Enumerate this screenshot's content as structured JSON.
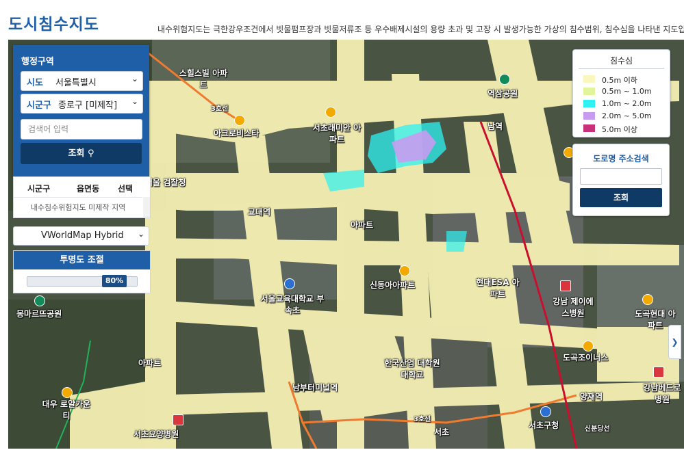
{
  "header": {
    "title": "도시침수지도",
    "description": "내수위험지도는 극한강우조건에서 빗물펌프장과 빗물저류조 등 우수배제시설의 용량 초과 및 고장 시 발생가능한 가상의 침수범위, 침수심을 나타낸 지도입"
  },
  "admin_panel": {
    "title": "행정구역",
    "sido": {
      "label": "시도",
      "value": "서울특별시"
    },
    "sigungu": {
      "label": "시군구",
      "value": "종로구 [미제작]"
    },
    "search": {
      "placeholder": "검색어 입력"
    },
    "query_button": "조회"
  },
  "result_table": {
    "columns": [
      "시군구",
      "읍면동",
      "선택"
    ],
    "empty_message": "내수침수위험지도 미제작 지역"
  },
  "basemap": {
    "value": "VWorldMap Hybrid"
  },
  "opacity": {
    "title": "투명도 조절",
    "value_label": "80%",
    "value": 0.8
  },
  "legend": {
    "title": "침수심",
    "items": [
      {
        "label": "0.5m 이하",
        "color": "#fbf6bd"
      },
      {
        "label": "0.5m ~ 1.0m",
        "color": "#e3f59a"
      },
      {
        "label": "1.0m ~ 2.0m",
        "color": "#2ef1f1"
      },
      {
        "label": "2.0m ~ 5.0m",
        "color": "#c79cf0"
      },
      {
        "label": "5.0m 이상",
        "color": "#c6317a"
      }
    ]
  },
  "road_search": {
    "title": "도로명 주소검색",
    "button": "조회"
  },
  "map_labels": {
    "p1": "남역",
    "p2": "역삼공원",
    "p3": "서초래미안 아파트",
    "p4": "아크로비스타",
    "p5": "몽마르뜨공원",
    "p6": "서울교육대학교 부속초",
    "p7": "강남 제이에스병원",
    "p8": "도곡현대 아파트",
    "p9": "도곡조이너스",
    "p10": "남부터미널역",
    "p11": "한국산업 대학원대학교",
    "p12": "대우 로얄가운티",
    "p13": "서초요양병원",
    "p14": "서초",
    "p15": "서초구청",
    "p16": "양재역",
    "p17": "강남베드로 병원",
    "p18": "아파트",
    "p19": "아파트",
    "p20": "신동아아파트",
    "p21": "현대ESA 아파트",
    "p22": "교대역",
    "p23": "서울 검찰청",
    "p24": "스힐스빌 아파트",
    "p25": "3호선",
    "p26": "3호선",
    "p27": "신분당선"
  },
  "colors": {
    "primary": "#1f5fa8",
    "dark_button": "#0f3a66",
    "map_background": "#46513d"
  }
}
